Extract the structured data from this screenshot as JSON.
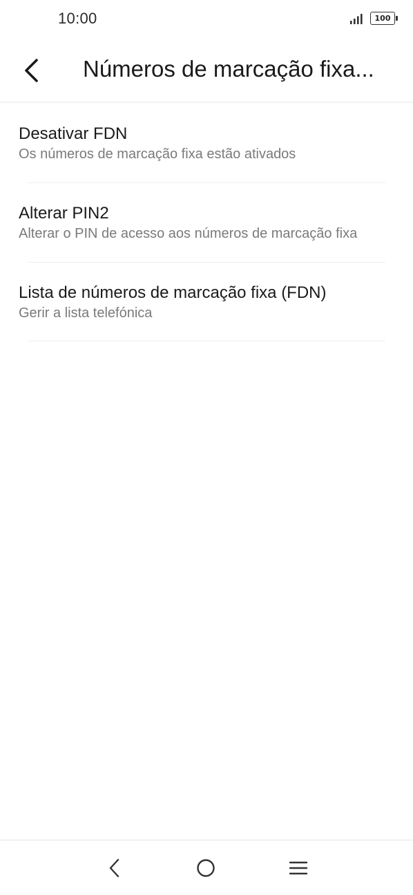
{
  "status_bar": {
    "time": "10:00",
    "battery": "100"
  },
  "app_bar": {
    "title": "Números de marcação fixa...",
    "back_icon": "chevron-left-icon"
  },
  "settings": {
    "items": [
      {
        "title": "Desativar FDN",
        "subtitle": "Os números de marcação fixa estão ativados"
      },
      {
        "title": "Alterar PIN2",
        "subtitle": "Alterar o PIN de acesso aos números de marcação fixa"
      },
      {
        "title": "Lista de números de marcação fixa (FDN)",
        "subtitle": "Gerir a lista telefónica"
      }
    ]
  },
  "nav_bar": {
    "back_icon": "nav-back-icon",
    "home_icon": "nav-home-icon",
    "menu_icon": "nav-menu-icon"
  }
}
